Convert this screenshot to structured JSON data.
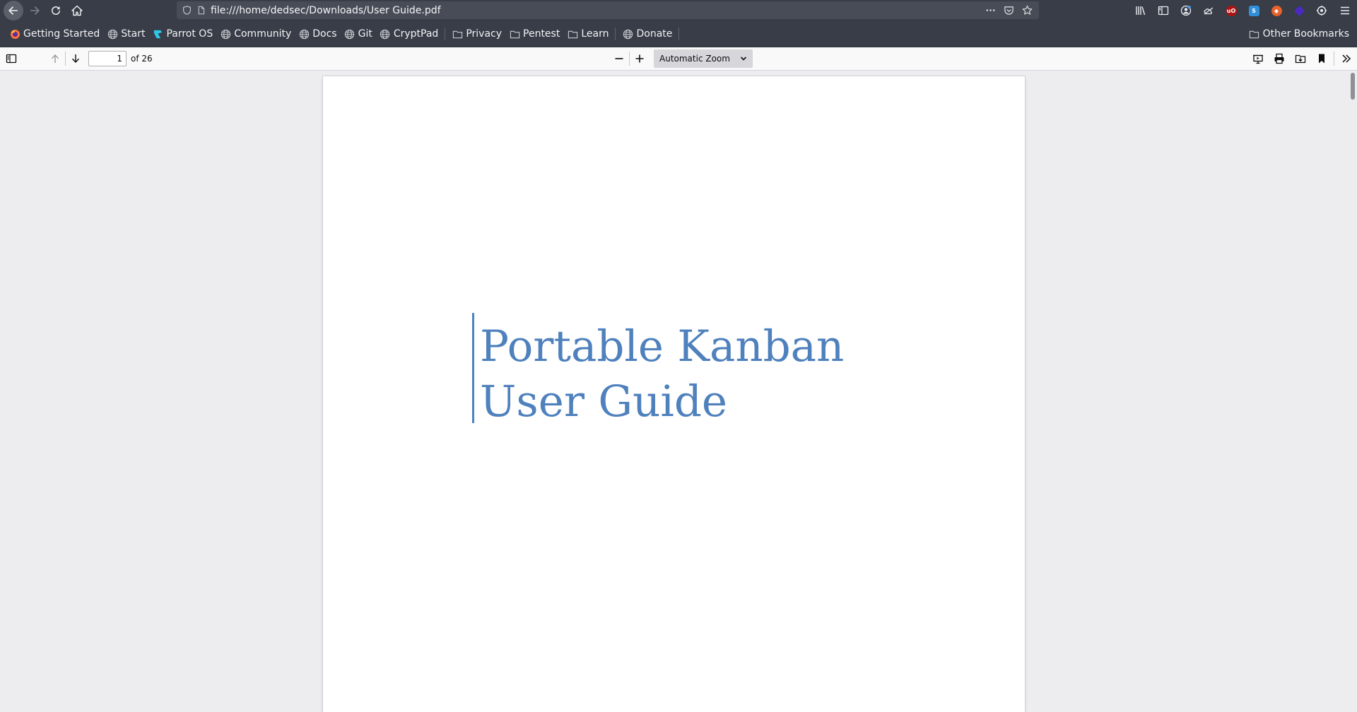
{
  "browser": {
    "url": "file:///home/dedsec/Downloads/User Guide.pdf"
  },
  "bookmarks": [
    {
      "label": "Getting Started",
      "icon": "firefox-icon"
    },
    {
      "label": "Start",
      "icon": "globe-icon"
    },
    {
      "label": "Parrot OS",
      "icon": "parrot-icon"
    },
    {
      "label": "Community",
      "icon": "globe-icon"
    },
    {
      "label": "Docs",
      "icon": "globe-icon"
    },
    {
      "label": "Git",
      "icon": "globe-icon"
    },
    {
      "label": "CryptPad",
      "icon": "globe-icon"
    },
    {
      "label": "Privacy",
      "icon": "folder-icon"
    },
    {
      "label": "Pentest",
      "icon": "folder-icon"
    },
    {
      "label": "Learn",
      "icon": "folder-icon"
    },
    {
      "label": "Donate",
      "icon": "globe-icon"
    }
  ],
  "other_bookmarks": "Other Bookmarks",
  "pdf": {
    "page_number": "1",
    "page_count": "of 26",
    "zoom": "Automatic Zoom"
  },
  "document": {
    "title_line1": "Portable Kanban",
    "title_line2": "User Guide"
  },
  "colors": {
    "title": "#4f81bd",
    "chrome": "#383d48"
  }
}
